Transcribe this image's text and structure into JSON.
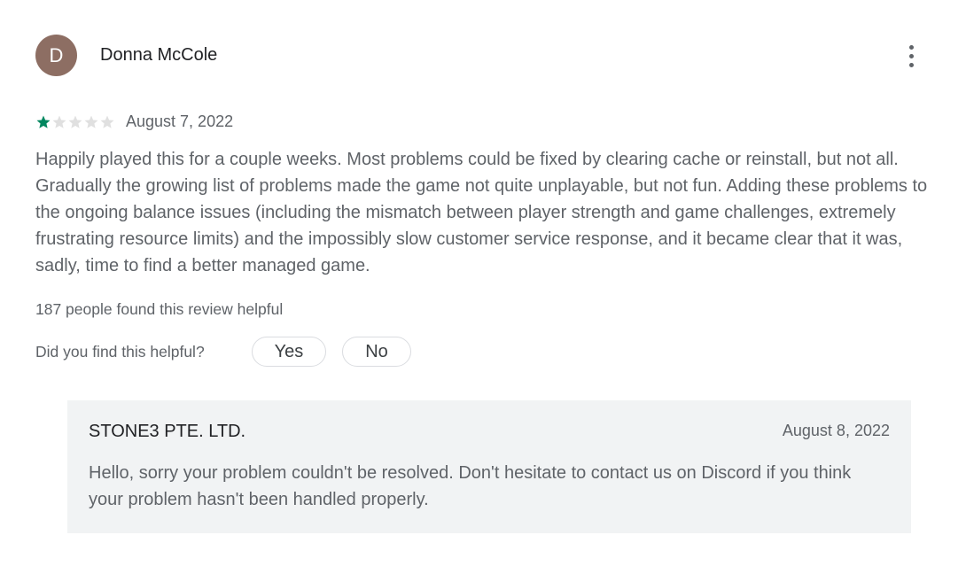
{
  "review": {
    "avatar_letter": "D",
    "avatar_color": "#8d6e63",
    "author": "Donna McCole",
    "more_icon": "more-vert-icon",
    "rating": 1,
    "rating_max": 5,
    "star_filled_color": "#01875f",
    "star_empty_color": "#e0e0e0",
    "date": "August 7, 2022",
    "text": "Happily played this for a couple weeks. Most problems could be fixed by clearing cache or reinstall, but not all. Gradually the growing list of problems made the game not quite unplayable, but not fun. Adding these problems to the ongoing balance issues (including the mismatch between player strength and game challenges, extremely frustrating resource limits) and the impossibly slow customer service response, and it became clear that it was, sadly, time to find a better managed game.",
    "helpful_count": "187 people found this review helpful",
    "helpful_question": "Did you find this helpful?",
    "yes_label": "Yes",
    "no_label": "No"
  },
  "reply": {
    "developer": "STONE3 PTE. LTD.",
    "date": "August 8, 2022",
    "text": "Hello, sorry your problem couldn't be resolved. Don't hesitate to contact us on Discord if you think your problem hasn't been handled properly."
  }
}
